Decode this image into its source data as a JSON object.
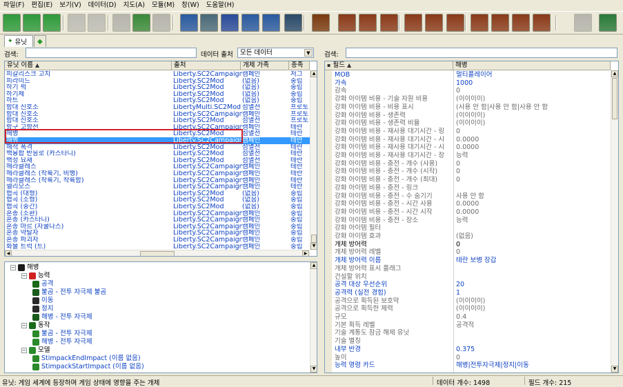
{
  "menu": [
    "파일(F)",
    "편집(E)",
    "보기(V)",
    "데이터(D)",
    "지도(A)",
    "모듈(M)",
    "창(W)",
    "도움말(H)"
  ],
  "tab": {
    "label": "유닛"
  },
  "left": {
    "search_label": "검색:",
    "source_label": "데이터 출처",
    "source_value": "모든 데이터",
    "columns": [
      "유닛 이름",
      "출처",
      "개체 가족",
      "종족"
    ],
    "rows": [
      [
        "피갈리스크 고치",
        "Liberty.SC2Campaign",
        "캠페인",
        "저그"
      ],
      [
        "피라미드",
        "Liberty.SC2Mod",
        "(없음)",
        "중립"
      ],
      [
        "하기 퍽",
        "Liberty.SC2Mod",
        "(없음)",
        "중립"
      ],
      [
        "하기체",
        "Liberty.SC2Mod",
        "(없음)",
        "중립"
      ],
      [
        "하트",
        "Liberty.SC2Mod",
        "(없음)",
        "중립"
      ],
      [
        "함대 신호소",
        "LibertyMulti.SC2Mod",
        "섬멸전",
        "프로토"
      ],
      [
        "함대 신호소",
        "Liberty.SC2Campaign",
        "캠페인",
        "프로토"
      ],
      [
        "함대 신호소",
        "Liberty.SC2Mod",
        "섬멸전",
        "프로토"
      ],
      [
        "항구 고향선",
        "Liberty.SC2Campaign",
        "캠페인",
        "테란"
      ],
      [
        "해병",
        "Liberty.SC2Mod",
        "섬멸전",
        "테란"
      ],
      [
        "해병",
        "Liberty.SC2Campaign",
        "캠페인",
        "테란"
      ],
      [
        "해적 폭격",
        "Liberty.SC2Mod",
        "섬멸전",
        "테란"
      ],
      [
        "핵융합 반응로 (카스타니)",
        "Liberty.SC2Mod",
        "섬멸전",
        "테란"
      ],
      [
        "핵성 요새",
        "Liberty.SC2Mod",
        "섬멸전",
        "테란"
      ],
      [
        "헤라클레스",
        "Liberty.SC2Campaign",
        "캠페인",
        "테란"
      ],
      [
        "헤라클레스 (착륙기, 비행)",
        "Liberty.SC2Campaign",
        "캠페인",
        "테란"
      ],
      [
        "헤라클레스 (착륙기, 착륙함)",
        "Liberty.SC2Campaign",
        "캠페인",
        "테란"
      ],
      [
        "헬리오스",
        "Liberty.SC2Campaign",
        "캠페인",
        "테란"
      ],
      [
        "협곡 (대형)",
        "Liberty.SC2Mod",
        "(없음)",
        "중립"
      ],
      [
        "협곡 (소형)",
        "Liberty.SC2Mod",
        "(없음)",
        "중립"
      ],
      [
        "협곡 (중간)",
        "Liberty.SC2Mod",
        "(없음)",
        "중립"
      ],
      [
        "혼종 (소환)",
        "Liberty.SC2Campaign",
        "캠페인",
        "중립"
      ],
      [
        "혼종 (카스타니)",
        "Liberty.SC2Campaign",
        "캠페인",
        "중립"
      ],
      [
        "혼종 마르 (자쿨다스)",
        "Liberty.SC2Campaign",
        "캠페인",
        "중립"
      ],
      [
        "혼종 약탈자",
        "Liberty.SC2Campaign",
        "캠페인",
        "중립"
      ],
      [
        "혼종 파괴자",
        "Liberty.SC2Campaign",
        "캠페인",
        "중립"
      ],
      [
        "화물 트럭 (트)",
        "Liberty.SC2Campaign",
        "캠페인",
        "중립"
      ]
    ],
    "tree": [
      {
        "level": 0,
        "label": "해병",
        "icon": "marine-icon"
      },
      {
        "level": 1,
        "label": "능력",
        "icon": "ability-category-icon"
      },
      {
        "level": 2,
        "label": "공격",
        "icon": "attack-icon"
      },
      {
        "level": 2,
        "label": "불곰 - 전투 자극제 불곰",
        "icon": "stimpack-icon"
      },
      {
        "level": 2,
        "label": "이동",
        "icon": "move-icon"
      },
      {
        "level": 2,
        "label": "정지",
        "icon": "stop-icon"
      },
      {
        "level": 2,
        "label": "해병 - 전투 자극제",
        "icon": "stimpack-icon"
      },
      {
        "level": 1,
        "label": "동작",
        "icon": "behavior-category-icon"
      },
      {
        "level": 2,
        "label": "불곰 - 전투 자극제",
        "icon": "behavior-icon"
      },
      {
        "level": 2,
        "label": "해병 - 전투 자극제",
        "icon": "behavior-icon"
      },
      {
        "level": 1,
        "label": "모델",
        "icon": "model-category-icon"
      },
      {
        "level": 2,
        "label": "StimpackEndImpact (이름 없음)",
        "icon": "model-icon"
      },
      {
        "level": 2,
        "label": "StimpackStartImpact (이름 없음)",
        "icon": "model-icon"
      }
    ]
  },
  "right": {
    "search_label": "검색:",
    "columns": [
      "필드",
      "해병"
    ],
    "rows": [
      [
        "MOB",
        "멀티플레이어",
        "blue"
      ],
      [
        "가속",
        "1000",
        "blue"
      ],
      [
        "감속",
        "0",
        "gray"
      ],
      [
        "강화 아이템 비용 - 기술 자원 비용",
        "(이이이이)",
        "gray"
      ],
      [
        "강화 아이템 비용 - 비용 표시",
        "(사용 안 함|사용 안 함|사용 안 함",
        "gray"
      ],
      [
        "강화 아이템 비용 - 생존력",
        "(이이이이)",
        "gray"
      ],
      [
        "강화 아이템 비용 - 생존력 비율",
        "(이이이이)",
        "gray"
      ],
      [
        "강화 아이템 비용 - 재사용 대기시간 - 링",
        "0",
        "gray"
      ],
      [
        "강화 아이템 비용 - 재사용 대기시간 - 시",
        "0.0000",
        "gray"
      ],
      [
        "강화 아이템 비용 - 재사용 대기시간 - 시",
        "0.0000",
        "gray"
      ],
      [
        "강화 아이템 비용 - 재사용 대기시간 - 장",
        "능력",
        "gray"
      ],
      [
        "강화 아이템 비용 - 충전 - 개수 (사용)",
        "0",
        "gray"
      ],
      [
        "강화 아이템 비용 - 충전 - 개수 (시작)",
        "0",
        "gray"
      ],
      [
        "강화 아이템 비용 - 충전 - 개수 (최대)",
        "0",
        "gray"
      ],
      [
        "강화 아이템 비용 - 충전 - 링크",
        "",
        "gray"
      ],
      [
        "강화 아이템 비용 - 충전 - 수 숨기기",
        "사용 안 함",
        "gray"
      ],
      [
        "강화 아이템 비용 - 충전 - 시간 사용",
        "0.0000",
        "gray"
      ],
      [
        "강화 아이템 비용 - 충전 - 시간 시작",
        "0.0000",
        "gray"
      ],
      [
        "강화 아이템 비용 - 충전 - 장소",
        "능력",
        "gray"
      ],
      [
        "강화 아이템 필터",
        "",
        "gray"
      ],
      [
        "강화 아이템 효과",
        "(없음)",
        "gray"
      ],
      [
        "개체 방어력",
        "0",
        "black"
      ],
      [
        "개체 방어력 레벨",
        "0",
        "gray"
      ],
      [
        "개체 방어력 이름",
        "테란 보병 장갑",
        "blue"
      ],
      [
        "개체 방어력 표시 플래그",
        "",
        "gray"
      ],
      [
        "건설할 위치",
        "",
        "gray"
      ],
      [
        "공격 대상 우선순위",
        "20",
        "blue"
      ],
      [
        "공격력 (실전 경험)",
        "1",
        "blue"
      ],
      [
        "공격으로 획득된 보호막",
        "(이이이이)",
        "gray"
      ],
      [
        "공격으로 획득한 체력",
        "(이이이이)",
        "gray"
      ],
      [
        "규모",
        "0.4",
        "gray"
      ],
      [
        "기본 획득 레벨",
        "공격적",
        "gray"
      ],
      [
        "기술 계통도 잠금 해제 유닛",
        "",
        "gray"
      ],
      [
        "기술 별칭",
        "",
        "gray"
      ],
      [
        "내부 반경",
        "0.375",
        "blue"
      ],
      [
        "높이",
        "0",
        "gray"
      ],
      [
        "능력 명령 카드",
        "해병|전투자극제|정지|이동",
        "blue"
      ]
    ]
  },
  "status": {
    "left": "유닛: 게임 세계에 등장하며 게임 상태에 영향을 주는 개체",
    "data_count": "데이터 개수: 1498",
    "field_count": "필드 개수: 215"
  }
}
